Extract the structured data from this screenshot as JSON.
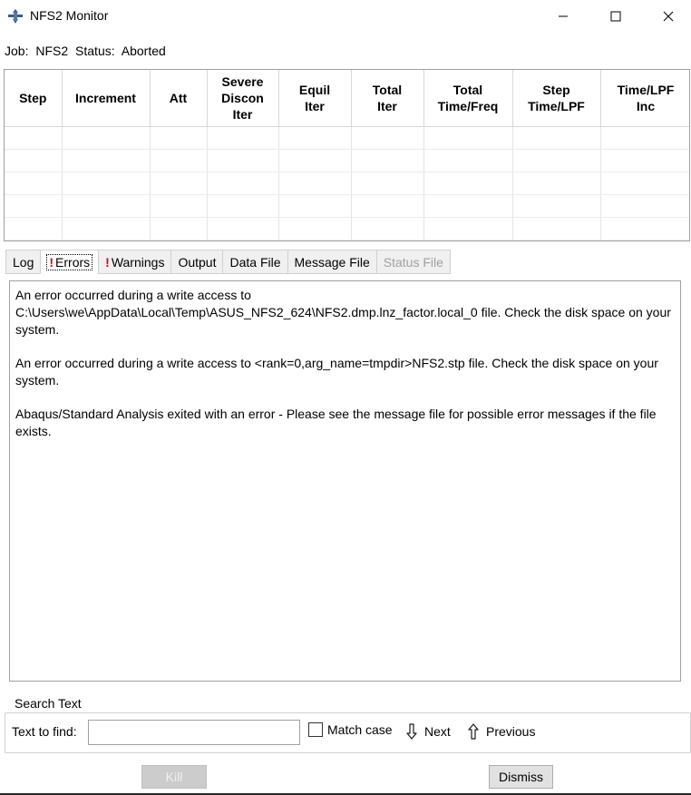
{
  "window": {
    "title": "NFS2 Monitor",
    "icon": "abaqus-app-icon",
    "controls": [
      "minimize-icon",
      "maximize-icon",
      "close-icon"
    ]
  },
  "job": {
    "job_label": "Job:",
    "job_value": "NFS2",
    "status_label": "Status:",
    "status_value": "Aborted"
  },
  "grid": {
    "columns": [
      [
        "Step"
      ],
      [
        "Increment"
      ],
      [
        "Att"
      ],
      [
        "Severe",
        "Discon",
        "Iter"
      ],
      [
        "Equil",
        "Iter"
      ],
      [
        "Total",
        "Iter"
      ],
      [
        "Total",
        "Time/Freq"
      ],
      [
        "Step",
        "Time/LPF"
      ],
      [
        "Time/LPF",
        "Inc"
      ]
    ],
    "rows": [
      [
        "",
        "",
        "",
        "",
        "",
        "",
        "",
        "",
        ""
      ],
      [
        "",
        "",
        "",
        "",
        "",
        "",
        "",
        "",
        ""
      ],
      [
        "",
        "",
        "",
        "",
        "",
        "",
        "",
        "",
        ""
      ],
      [
        "",
        "",
        "",
        "",
        "",
        "",
        "",
        "",
        ""
      ],
      [
        "",
        "",
        "",
        "",
        "",
        "",
        "",
        "",
        ""
      ]
    ]
  },
  "tabs": {
    "log": "Log",
    "errors": "Errors",
    "warnings": "Warnings",
    "output": "Output",
    "data_file": "Data File",
    "message_file": "Message File",
    "status_file": "Status File",
    "alert_mark": "!",
    "active": "errors"
  },
  "messages": {
    "error1": "An error occurred during a write access to C:\\Users\\we\\AppData\\Local\\Temp\\ASUS_NFS2_624\\NFS2.dmp.lnz_factor.local_0 file. Check the disk space on your system.",
    "error2": "An error occurred during a write access to <rank=0,arg_name=tmpdir>NFS2.stp file. Check the disk space on your system.",
    "error3": "Abaqus/Standard Analysis exited with an error - Please see the  message file for possible error messages if the file exists."
  },
  "search": {
    "group_label": "Search Text",
    "find_label": "Text to find:",
    "find_value": "",
    "match_case_label": "Match case",
    "match_case_checked": false,
    "next_label": "Next",
    "previous_label": "Previous"
  },
  "buttons": {
    "kill": "Kill",
    "dismiss": "Dismiss"
  },
  "colors": {
    "alert": "#e00000",
    "disabled_text": "#a0a0a0"
  }
}
